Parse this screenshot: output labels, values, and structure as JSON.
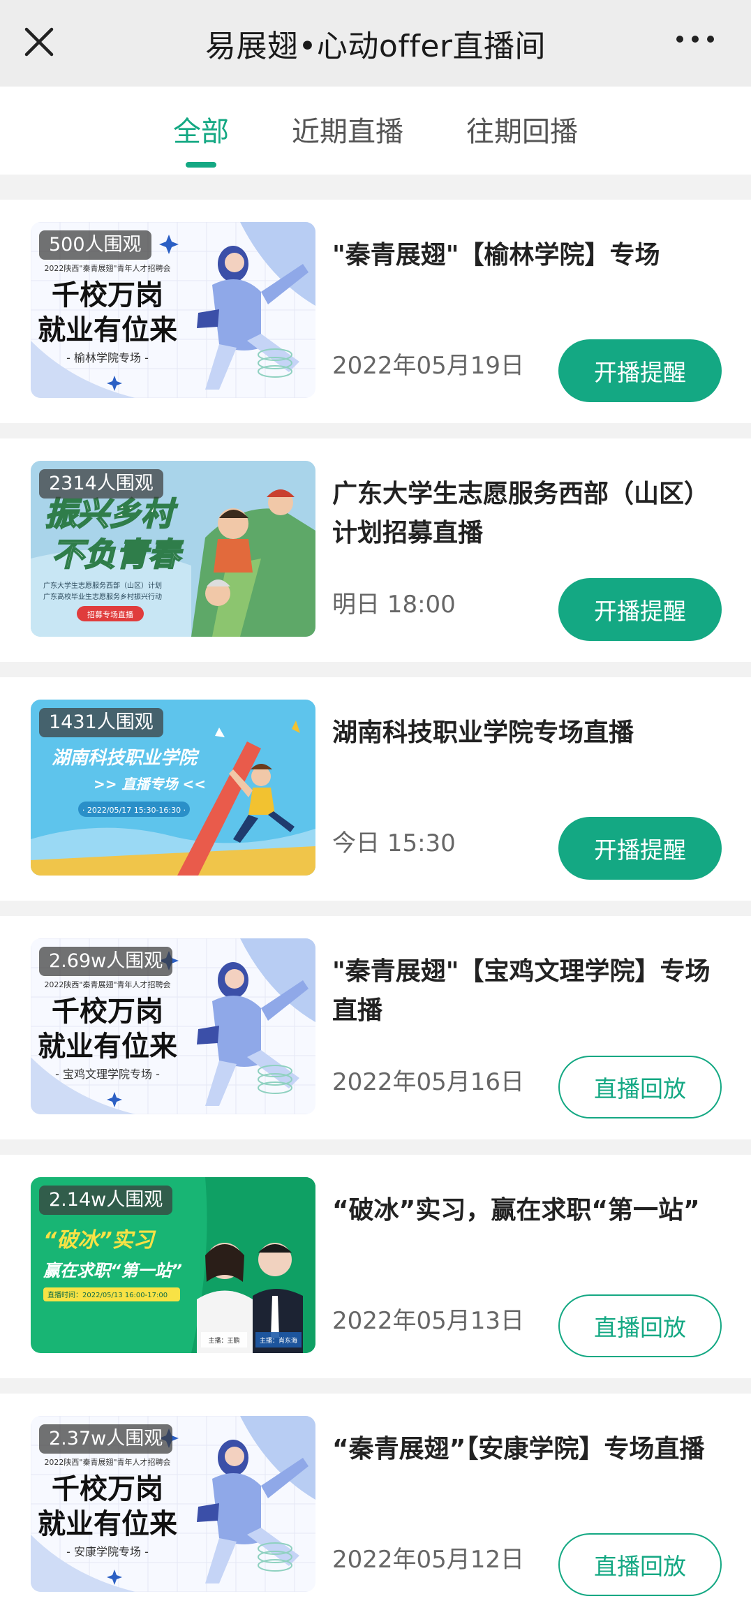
{
  "header": {
    "title": "易展翅•心动offer直播间",
    "close_icon": "close-icon",
    "more_icon": "more-icon"
  },
  "tabs": [
    {
      "label": "全部",
      "active": true
    },
    {
      "label": "近期直播",
      "active": false
    },
    {
      "label": "往期回播",
      "active": false
    }
  ],
  "colors": {
    "accent": "#14a883",
    "header_bg": "#ededed",
    "page_bg": "#f2f2f2"
  },
  "cards": [
    {
      "views": "500人围观",
      "title": "\"秦青展翅\"【榆林学院】专场",
      "date": "2022年05月19日",
      "button": "开播提醒",
      "button_style": "filled",
      "thumb": {
        "theme": "qinqing",
        "banner": "2022陕西\"秦青展翅\"青年人才招聘会",
        "line1": "千校万岗",
        "line2": "就业有位来",
        "sub": "- 榆林学院专场 -"
      }
    },
    {
      "views": "2314人围观",
      "title": "广东大学生志愿服务西部（山区）计划招募直播",
      "date": "明日 18:00",
      "button": "开播提醒",
      "button_style": "filled",
      "thumb": {
        "theme": "rural",
        "line1": "振兴乡村",
        "line2": "不负青春",
        "sub1": "广东大学生志愿服务西部（山区）计划",
        "sub2": "广东高校毕业生志愿服务乡村振兴行动",
        "tag": "招募专场直播"
      }
    },
    {
      "views": "1431人围观",
      "title": "湖南科技职业学院专场直播",
      "date": "今日 15:30",
      "button": "开播提醒",
      "button_style": "filled",
      "thumb": {
        "theme": "hunan",
        "line1": "湖南科技职业学院",
        "line2": ">> 直播专场 <<",
        "sub": "· 2022/05/17 15:30-16:30 ·"
      }
    },
    {
      "views": "2.69w人围观",
      "title": "\"秦青展翅\"【宝鸡文理学院】专场直播",
      "date": "2022年05月16日",
      "button": "直播回放",
      "button_style": "outline",
      "thumb": {
        "theme": "qinqing",
        "banner": "2022陕西\"秦青展翅\"青年人才招聘会",
        "line1": "千校万岗",
        "line2": "就业有位来",
        "sub": "- 宝鸡文理学院专场 -"
      }
    },
    {
      "views": "2.14w人围观",
      "title": "“破冰”实习，赢在求职“第一站”",
      "date": "2022年05月13日",
      "button": "直播回放",
      "button_style": "outline",
      "thumb": {
        "theme": "icebreak",
        "line1": "“破冰”实习",
        "line2": "赢在求职“第一站”",
        "sub": "直播时间：2022/05/13 16:00-17:00",
        "host1": "主播：王鹏",
        "host2": "主播：肖东海"
      }
    },
    {
      "views": "2.37w人围观",
      "title": "“秦青展翅”【安康学院】专场直播",
      "date": "2022年05月12日",
      "button": "直播回放",
      "button_style": "outline",
      "thumb": {
        "theme": "qinqing",
        "banner": "2022陕西\"秦青展翅\"青年人才招聘会",
        "line1": "千校万岗",
        "line2": "就业有位来",
        "sub": "- 安康学院专场 -"
      }
    }
  ]
}
